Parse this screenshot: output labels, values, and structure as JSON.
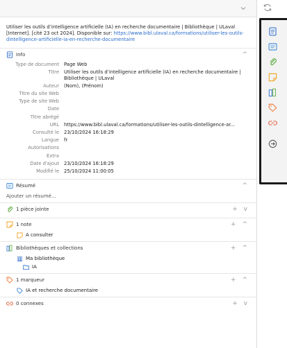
{
  "citation": {
    "text": "Utiliser les outils d’intelligence artificielle (IA) en recherche documentaire | Bibliothèque | ULaval [Internet]. [cité 23 oct 2024]. Disponible sur: ",
    "url": "https://www.bibl.ulaval.ca/formations/utiliser-les-outils-dintelligence-artificielle-ia-en-recherche-documentaire"
  },
  "info": {
    "title": "Info",
    "rows": [
      {
        "label": "Type de document",
        "value": "Page Web"
      },
      {
        "label": "Titre",
        "value": "Utiliser les outils d’intelligence artificielle (IA) en recherche documentaire | Bibliothèque | ULaval"
      },
      {
        "label": "Auteur",
        "value": "(Nom), (Prénom)"
      },
      {
        "label": "Titre du site Web",
        "value": ""
      },
      {
        "label": "Type de site Web",
        "value": ""
      },
      {
        "label": "Date",
        "value": ""
      },
      {
        "label": "Titre abrégé",
        "value": ""
      },
      {
        "label": "URL",
        "value": "https://www.bibl.ulaval.ca/formations/utiliser-les-outils-dintelligence-ar..."
      },
      {
        "label": "Consulté le",
        "value": "23/10/2024 16:18:29"
      },
      {
        "label": "Langue",
        "value": "fr"
      },
      {
        "label": "Autorisations",
        "value": ""
      },
      {
        "label": "Extra",
        "value": ""
      },
      {
        "label": "Date d'ajout",
        "value": "23/10/2024 16:18:29"
      },
      {
        "label": "Modifié le",
        "value": "25/10/2024 11:00:05"
      }
    ]
  },
  "resume": {
    "title": "Résumé",
    "placeholder": "Ajouter un résumé..."
  },
  "attachments": {
    "title": "1 pièce jointe"
  },
  "notes": {
    "title": "1 note",
    "items": [
      "A consulter"
    ]
  },
  "libraries": {
    "title": "Bibliothèques et collections",
    "library": "Ma bibliothèque",
    "collection": "IA"
  },
  "tags": {
    "title": "1 marqueur",
    "items": [
      "IA et recherche documentaire"
    ]
  },
  "related": {
    "title": "0 connexes"
  },
  "controls": {
    "plus": "+",
    "collapse": "^",
    "expand": "v"
  },
  "colors": {
    "info": "#2a6bcc",
    "resume": "#3c8ad8",
    "attachment": "#5aaa3c",
    "note": "#f0a11e",
    "library": "#2a6bcc",
    "tag": "#ee7733",
    "related": "#e0603e"
  }
}
